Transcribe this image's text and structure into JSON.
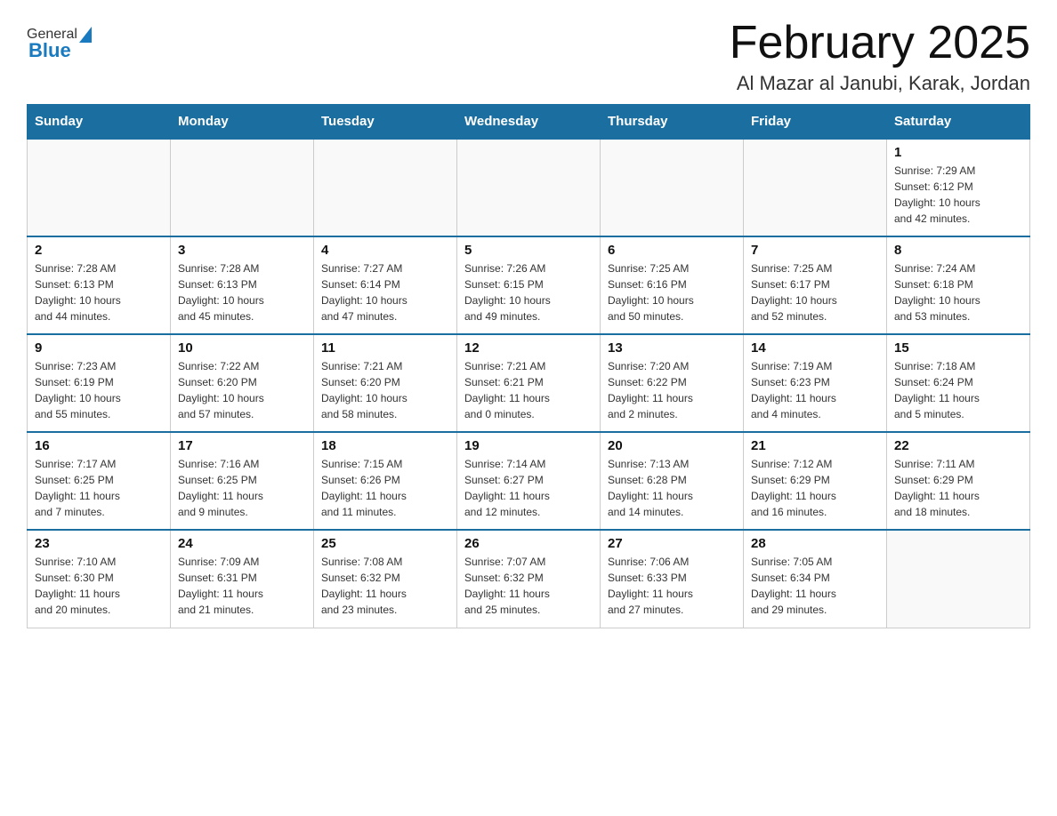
{
  "header": {
    "logo": {
      "general": "General",
      "blue": "Blue"
    },
    "title": "February 2025",
    "location": "Al Mazar al Janubi, Karak, Jordan"
  },
  "days_of_week": [
    "Sunday",
    "Monday",
    "Tuesday",
    "Wednesday",
    "Thursday",
    "Friday",
    "Saturday"
  ],
  "weeks": [
    [
      {
        "day": "",
        "info": ""
      },
      {
        "day": "",
        "info": ""
      },
      {
        "day": "",
        "info": ""
      },
      {
        "day": "",
        "info": ""
      },
      {
        "day": "",
        "info": ""
      },
      {
        "day": "",
        "info": ""
      },
      {
        "day": "1",
        "info": "Sunrise: 7:29 AM\nSunset: 6:12 PM\nDaylight: 10 hours\nand 42 minutes."
      }
    ],
    [
      {
        "day": "2",
        "info": "Sunrise: 7:28 AM\nSunset: 6:13 PM\nDaylight: 10 hours\nand 44 minutes."
      },
      {
        "day": "3",
        "info": "Sunrise: 7:28 AM\nSunset: 6:13 PM\nDaylight: 10 hours\nand 45 minutes."
      },
      {
        "day": "4",
        "info": "Sunrise: 7:27 AM\nSunset: 6:14 PM\nDaylight: 10 hours\nand 47 minutes."
      },
      {
        "day": "5",
        "info": "Sunrise: 7:26 AM\nSunset: 6:15 PM\nDaylight: 10 hours\nand 49 minutes."
      },
      {
        "day": "6",
        "info": "Sunrise: 7:25 AM\nSunset: 6:16 PM\nDaylight: 10 hours\nand 50 minutes."
      },
      {
        "day": "7",
        "info": "Sunrise: 7:25 AM\nSunset: 6:17 PM\nDaylight: 10 hours\nand 52 minutes."
      },
      {
        "day": "8",
        "info": "Sunrise: 7:24 AM\nSunset: 6:18 PM\nDaylight: 10 hours\nand 53 minutes."
      }
    ],
    [
      {
        "day": "9",
        "info": "Sunrise: 7:23 AM\nSunset: 6:19 PM\nDaylight: 10 hours\nand 55 minutes."
      },
      {
        "day": "10",
        "info": "Sunrise: 7:22 AM\nSunset: 6:20 PM\nDaylight: 10 hours\nand 57 minutes."
      },
      {
        "day": "11",
        "info": "Sunrise: 7:21 AM\nSunset: 6:20 PM\nDaylight: 10 hours\nand 58 minutes."
      },
      {
        "day": "12",
        "info": "Sunrise: 7:21 AM\nSunset: 6:21 PM\nDaylight: 11 hours\nand 0 minutes."
      },
      {
        "day": "13",
        "info": "Sunrise: 7:20 AM\nSunset: 6:22 PM\nDaylight: 11 hours\nand 2 minutes."
      },
      {
        "day": "14",
        "info": "Sunrise: 7:19 AM\nSunset: 6:23 PM\nDaylight: 11 hours\nand 4 minutes."
      },
      {
        "day": "15",
        "info": "Sunrise: 7:18 AM\nSunset: 6:24 PM\nDaylight: 11 hours\nand 5 minutes."
      }
    ],
    [
      {
        "day": "16",
        "info": "Sunrise: 7:17 AM\nSunset: 6:25 PM\nDaylight: 11 hours\nand 7 minutes."
      },
      {
        "day": "17",
        "info": "Sunrise: 7:16 AM\nSunset: 6:25 PM\nDaylight: 11 hours\nand 9 minutes."
      },
      {
        "day": "18",
        "info": "Sunrise: 7:15 AM\nSunset: 6:26 PM\nDaylight: 11 hours\nand 11 minutes."
      },
      {
        "day": "19",
        "info": "Sunrise: 7:14 AM\nSunset: 6:27 PM\nDaylight: 11 hours\nand 12 minutes."
      },
      {
        "day": "20",
        "info": "Sunrise: 7:13 AM\nSunset: 6:28 PM\nDaylight: 11 hours\nand 14 minutes."
      },
      {
        "day": "21",
        "info": "Sunrise: 7:12 AM\nSunset: 6:29 PM\nDaylight: 11 hours\nand 16 minutes."
      },
      {
        "day": "22",
        "info": "Sunrise: 7:11 AM\nSunset: 6:29 PM\nDaylight: 11 hours\nand 18 minutes."
      }
    ],
    [
      {
        "day": "23",
        "info": "Sunrise: 7:10 AM\nSunset: 6:30 PM\nDaylight: 11 hours\nand 20 minutes."
      },
      {
        "day": "24",
        "info": "Sunrise: 7:09 AM\nSunset: 6:31 PM\nDaylight: 11 hours\nand 21 minutes."
      },
      {
        "day": "25",
        "info": "Sunrise: 7:08 AM\nSunset: 6:32 PM\nDaylight: 11 hours\nand 23 minutes."
      },
      {
        "day": "26",
        "info": "Sunrise: 7:07 AM\nSunset: 6:32 PM\nDaylight: 11 hours\nand 25 minutes."
      },
      {
        "day": "27",
        "info": "Sunrise: 7:06 AM\nSunset: 6:33 PM\nDaylight: 11 hours\nand 27 minutes."
      },
      {
        "day": "28",
        "info": "Sunrise: 7:05 AM\nSunset: 6:34 PM\nDaylight: 11 hours\nand 29 minutes."
      },
      {
        "day": "",
        "info": ""
      }
    ]
  ]
}
